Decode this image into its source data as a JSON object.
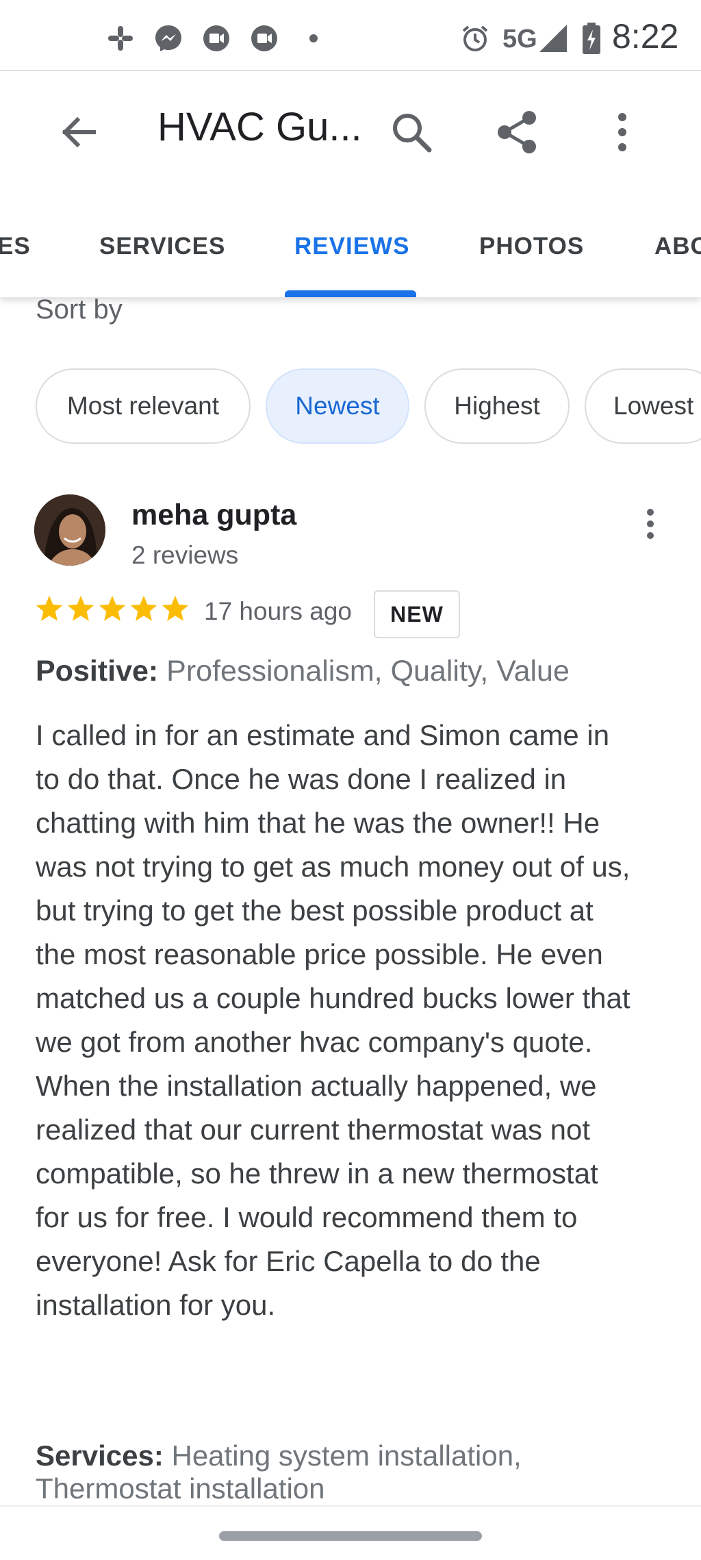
{
  "status_bar": {
    "time": "8:22",
    "network": "5G",
    "notification_icons": [
      "slack-icon",
      "messenger-icon",
      "video-icon",
      "video-icon",
      "dot-icon"
    ],
    "system_icons": [
      "alarm-icon",
      "signal-icon",
      "battery-charging-icon"
    ]
  },
  "app_bar": {
    "title": "HVAC Gu...",
    "back_icon": "back-arrow-icon",
    "search_icon": "search-icon",
    "share_icon": "share-icon",
    "more_icon": "more-vert-icon"
  },
  "tabs": {
    "items": [
      {
        "label": "ES"
      },
      {
        "label": "SERVICES"
      },
      {
        "label": "REVIEWS"
      },
      {
        "label": "PHOTOS"
      },
      {
        "label": "ABO"
      }
    ],
    "active": "REVIEWS",
    "active_color": "#1a73e8"
  },
  "sort": {
    "label": "Sort by",
    "chips": [
      {
        "label": "Most relevant"
      },
      {
        "label": "Newest"
      },
      {
        "label": "Highest"
      },
      {
        "label": "Lowest"
      }
    ],
    "selected": "Newest"
  },
  "review": {
    "reviewer_name": "meha gupta",
    "reviewer_meta": "2 reviews",
    "rating": 5,
    "rating_max": 5,
    "star_color": "#fbbc04",
    "time": "17 hours ago",
    "badge": "NEW",
    "positive_label": "Positive:",
    "positive_value": " Professionalism, Quality, Value",
    "text": "I called in for an estimate and Simon came in to do that. Once he was done I realized in chatting with him that he was the owner!! He was not trying to get as much money out of us, but trying to get the best possible product at the most reasonable price possible. He even matched us a couple hundred bucks lower that we got from another hvac company's quote. When the installation actually happened, we realized that our current thermostat was not compatible, so he threw in a new thermostat for us for free. I would recommend them to everyone! Ask for Eric Capella to do the installation for you.",
    "services_label": "Services:",
    "services_value": " Heating system installation, Thermostat installation"
  }
}
